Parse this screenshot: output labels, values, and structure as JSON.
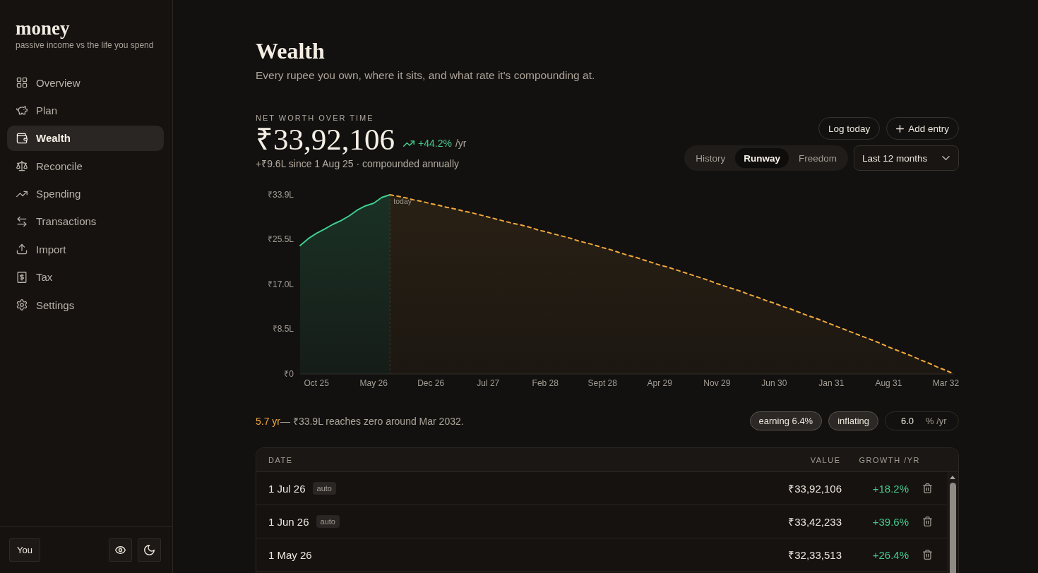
{
  "sidebar": {
    "logo": "money",
    "tagline": "passive income vs the life you spend",
    "items": [
      {
        "label": "Overview",
        "selected": false
      },
      {
        "label": "Plan",
        "selected": false
      },
      {
        "label": "Wealth",
        "selected": true
      },
      {
        "label": "Reconcile",
        "selected": false
      },
      {
        "label": "Spending",
        "selected": false
      },
      {
        "label": "Transactions",
        "selected": false
      },
      {
        "label": "Import",
        "selected": false
      },
      {
        "label": "Tax",
        "selected": false
      },
      {
        "label": "Settings",
        "selected": false
      }
    ],
    "footer": {
      "profile_button": "You"
    }
  },
  "page": {
    "title": "Wealth",
    "subtitle": "Every rupee you own, where it sits, and what rate it's compounding at."
  },
  "net_worth": {
    "label": "NET WORTH OVER TIME",
    "value": "₹33,92,106",
    "growth": "+44.2%",
    "growth_unit": "/yr",
    "change": "+₹9.6L since 1 Aug 25 · compounded annually"
  },
  "actions": [
    {
      "label": "Log today",
      "kind": "plain"
    },
    {
      "label": "Add entry",
      "kind": "add"
    }
  ],
  "view_tabs": [
    {
      "label": "History",
      "selected": false
    },
    {
      "label": "Runway",
      "selected": true
    },
    {
      "label": "Freedom",
      "selected": false
    }
  ],
  "range_select": {
    "value": "Last 12 months"
  },
  "chart": {
    "chart_data": {
      "type": "area",
      "categories": [
        null,
        null,
        "Oct 25",
        null,
        null,
        null,
        null,
        null,
        null,
        "May 26",
        null,
        null,
        null,
        null,
        null,
        null,
        "Dec 26",
        null,
        null,
        null,
        null,
        null,
        null,
        "Jul 27",
        null,
        null,
        null,
        null,
        null,
        null,
        "Feb 28",
        null,
        null,
        null,
        null,
        null,
        null,
        "Sept 28",
        null,
        null,
        null,
        null,
        null,
        null,
        "Apr 29",
        null,
        null,
        null,
        null,
        null,
        null,
        "Nov 29",
        null,
        null,
        null,
        null,
        null,
        null,
        "Jun 30",
        null,
        null,
        null,
        null,
        null,
        null,
        "Jan 31",
        null,
        null,
        null,
        null,
        null,
        null,
        "Aug 31",
        null,
        null,
        null,
        null,
        null,
        null,
        "Mar 32",
        null
      ],
      "ylim": [
        0,
        33.9
      ],
      "yticks": [
        {
          "value": 0,
          "label": "₹0"
        },
        {
          "value": 8.5,
          "label": "₹8.5L"
        },
        {
          "value": 17,
          "label": "₹17.0L"
        },
        {
          "value": 25.5,
          "label": "₹25.5L"
        },
        {
          "value": 33.9,
          "label": "₹33.9L"
        }
      ],
      "series": [
        {
          "color": "#3ecf8e",
          "line_style": "solid",
          "values": [
            24.3,
            25.6,
            26.6,
            27.4,
            28.3,
            29.0,
            29.9,
            31.0,
            31.8,
            32.3,
            33.4,
            33.9,
            null,
            null,
            null,
            null,
            null,
            null,
            null,
            null,
            null,
            null,
            null,
            null,
            null,
            null,
            null,
            null,
            null,
            null,
            null,
            null,
            null,
            null,
            null,
            null,
            null,
            null,
            null,
            null,
            null,
            null,
            null,
            null,
            null,
            null,
            null,
            null,
            null,
            null,
            null,
            null,
            null,
            null,
            null,
            null,
            null,
            null,
            null,
            null,
            null,
            null,
            null,
            null,
            null,
            null,
            null,
            null,
            null,
            null,
            null,
            null,
            null,
            null,
            null,
            null,
            null,
            null,
            null,
            null,
            null
          ]
        },
        {
          "color": "#f2a93b",
          "line_style": "dashed",
          "values": [
            null,
            null,
            null,
            null,
            null,
            null,
            null,
            null,
            null,
            null,
            null,
            33.9,
            33.6,
            33.3,
            32.9,
            32.6,
            32.2,
            31.9,
            31.5,
            31.2,
            30.8,
            30.5,
            30.1,
            29.7,
            29.3,
            28.9,
            28.5,
            28.2,
            27.8,
            27.3,
            26.9,
            26.5,
            26.1,
            25.7,
            25.2,
            24.8,
            24.4,
            23.9,
            23.5,
            23.0,
            22.5,
            22.1,
            21.6,
            21.1,
            20.6,
            20.2,
            19.7,
            19.2,
            18.7,
            18.2,
            17.7,
            17.1,
            16.6,
            16.1,
            15.6,
            15.0,
            14.5,
            13.9,
            13.4,
            12.8,
            12.3,
            11.7,
            11.1,
            10.6,
            10.0,
            9.4,
            8.8,
            8.2,
            7.6,
            7.0,
            6.4,
            5.8,
            5.1,
            4.5,
            3.9,
            3.3,
            2.6,
            2.0,
            1.3,
            0.7,
            0
          ]
        }
      ],
      "annotations": [
        {
          "text": "today"
        }
      ]
    }
  },
  "runway": {
    "years": "5.7 yr",
    "summary": "— ₹33.9L reaches zero around Mar 2032.",
    "chips": [
      "earning 6.4%",
      "inflating"
    ],
    "rate_field": {
      "value": "6.0",
      "unit": "% /yr"
    }
  },
  "table": {
    "columns": [
      "DATE",
      "VALUE",
      "GROWTH /YR"
    ],
    "rows": [
      {
        "date": "1 Jul 26",
        "tag": "auto",
        "value": "₹33,92,106",
        "growth": "+18.2%"
      },
      {
        "date": "1 Jun 26",
        "tag": "auto",
        "value": "₹33,42,233",
        "growth": "+39.6%"
      },
      {
        "date": "1 May 26",
        "value": "₹32,33,513",
        "growth": "+26.4%"
      }
    ]
  }
}
